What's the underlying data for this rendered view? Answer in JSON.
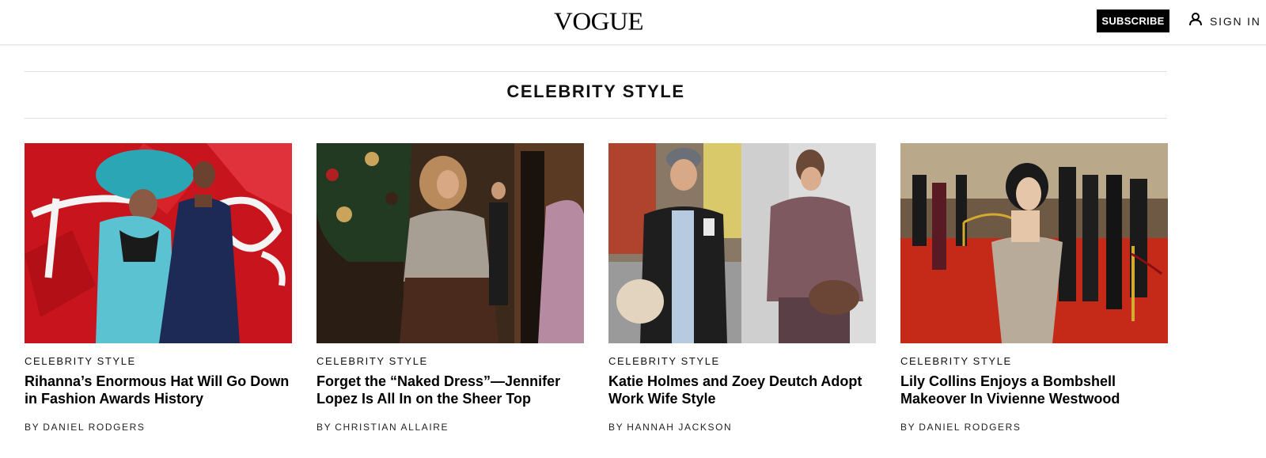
{
  "header": {
    "logo": "VOGUE",
    "subscribe_label": "SUBSCRIBE",
    "signin_label": "SIGN IN",
    "icons": {
      "account": "person-icon"
    }
  },
  "section": {
    "title": "CELEBRITY STYLE"
  },
  "cards": [
    {
      "rubric": "CELEBRITY STYLE",
      "title": "Rihanna’s Enormous Hat Will Go Down in Fashion Awards History",
      "by": "BY",
      "author": "DANIEL RODGERS",
      "image": "photo-red-backdrop-blue-fur-hat"
    },
    {
      "rubric": "CELEBRITY STYLE",
      "title": "Forget the “Naked Dress”—Jennifer Lopez Is All In on the Sheer Top",
      "by": "BY",
      "author": "CHRISTIAN ALLAIRE",
      "image": "photo-sheer-top-christmas-tree"
    },
    {
      "rubric": "CELEBRITY STYLE",
      "title": "Katie Holmes and Zoey Deutch Adopt Work Wife Style",
      "by": "BY",
      "author": "HANNAH JACKSON",
      "image": "photo-street-style-split"
    },
    {
      "rubric": "CELEBRITY STYLE",
      "title": "Lily Collins Enjoys a Bombshell Makeover In Vivienne Westwood",
      "by": "BY",
      "author": "DANIEL RODGERS",
      "image": "photo-red-carpet-silver-gown"
    }
  ],
  "colors": {
    "subscribe_bg": "#000000",
    "rule": "#e0e0e0",
    "text": "#000000"
  }
}
